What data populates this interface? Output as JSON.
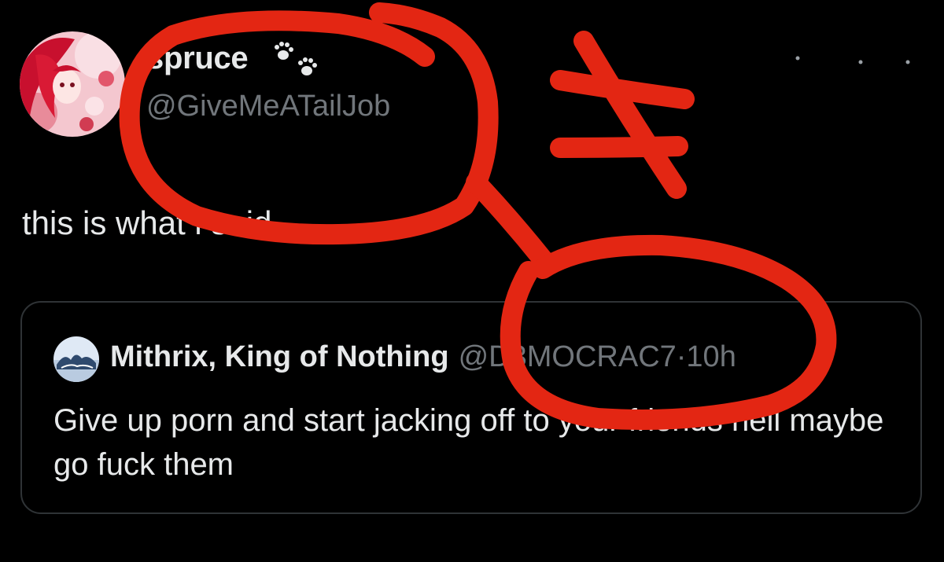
{
  "author": {
    "display_name": "spruce",
    "handle": "@GiveMeATailJob",
    "avatar_icon": "anime-avatar",
    "badge_icon": "paw-prints-icon"
  },
  "tweet": {
    "text": "this is what i said"
  },
  "quote": {
    "display_name": "Mithrix, King of Nothing",
    "handle": "@D3MOCRAC7",
    "separator": "·",
    "time": "10h",
    "body": "Give up porn and start jacking off to your friends hell maybe go fuck them"
  },
  "annotation": {
    "color": "#e32613",
    "symbol": "not-equal-sign"
  },
  "colors": {
    "background": "#000000",
    "primary_text": "#e7e9ea",
    "secondary_text": "#71767b",
    "card_border": "#2f3336"
  }
}
